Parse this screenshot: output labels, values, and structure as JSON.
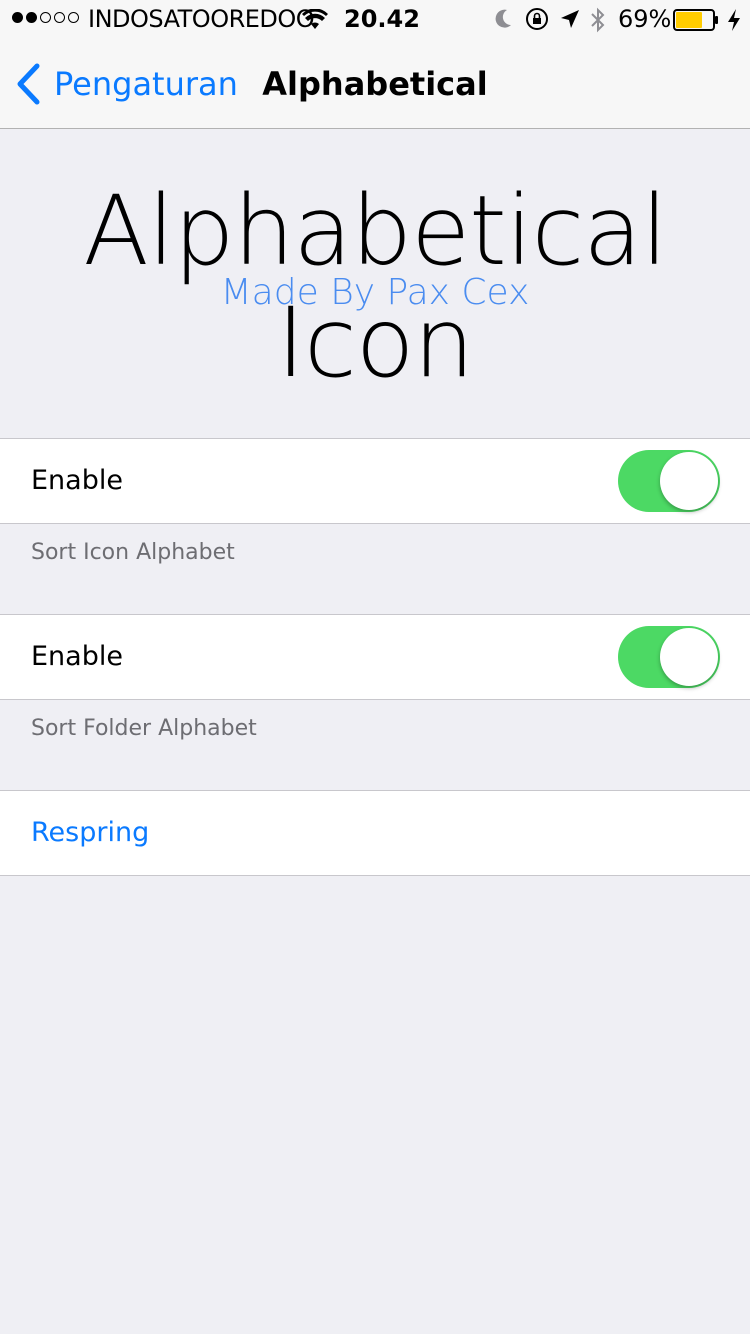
{
  "status_bar": {
    "carrier": "INDOSATOOREDOO",
    "time": "20.42",
    "battery_percent": "69%",
    "signal_strength": 2,
    "signal_max": 5,
    "icons": [
      "wifi-icon",
      "moon-icon",
      "rotation-lock-icon",
      "location-icon",
      "bluetooth-icon",
      "battery-icon",
      "charging-icon"
    ],
    "battery_color": "#ffcc00"
  },
  "nav": {
    "back_label": "Pengaturan",
    "title": "Alphabetical"
  },
  "banner": {
    "title": "Alphabetical Icon",
    "subtitle": "Made By Pax Cex"
  },
  "sections": [
    {
      "label": "Enable",
      "toggle_on": true,
      "footer": "Sort Icon Alphabet"
    },
    {
      "label": "Enable",
      "toggle_on": true,
      "footer": "Sort Folder Alphabet"
    }
  ],
  "respring": {
    "label": "Respring"
  },
  "colors": {
    "accent": "#0a7aff",
    "toggle_on": "#4cd964",
    "background": "#efeff4",
    "subtitle": "#4a8cf0"
  }
}
